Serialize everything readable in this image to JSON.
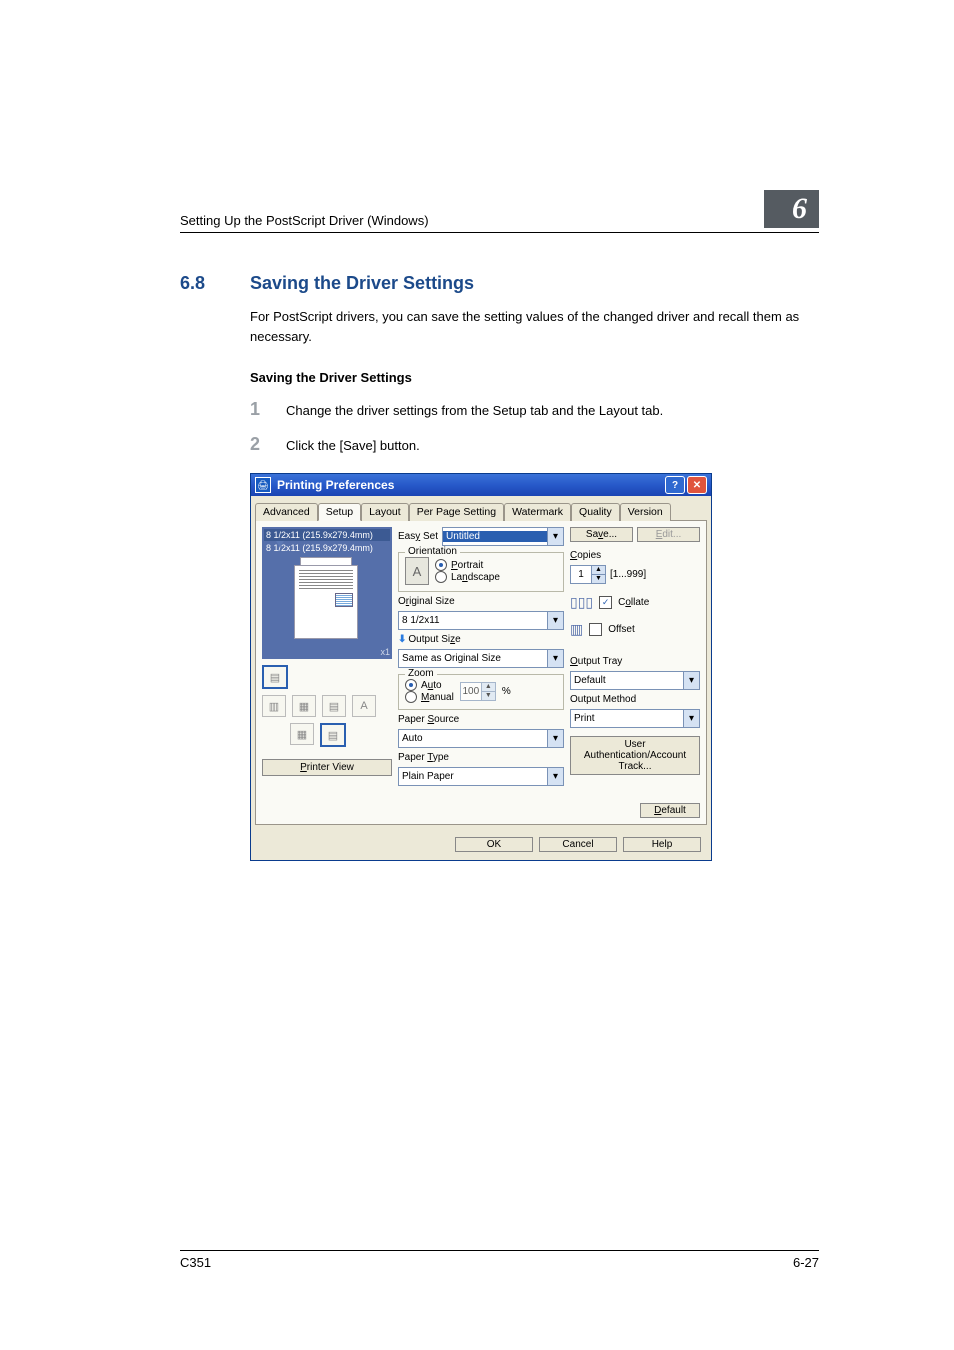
{
  "page": {
    "header_left": "Setting Up the PostScript Driver (Windows)",
    "chapter_badge": "6",
    "section_number": "6.8",
    "section_title": "Saving the Driver Settings",
    "intro": "For PostScript drivers, you can save the setting values of the changed driver and recall them as necessary.",
    "sub_heading": "Saving the Driver Settings",
    "steps": [
      "Change the driver settings from the Setup tab and the Layout tab.",
      "Click the [Save] button."
    ],
    "footer_left": "C351",
    "footer_right": "6-27"
  },
  "dialog": {
    "title": "Printing Preferences",
    "tabs": [
      "Advanced",
      "Setup",
      "Layout",
      "Per Page Setting",
      "Watermark",
      "Quality",
      "Version"
    ],
    "selected_tab": "Setup",
    "easy_set_label": "Easy Set",
    "easy_set_value": "Untitled",
    "save_btn": "Save...",
    "edit_btn": "Edit...",
    "preview": {
      "line1": "8 1/2x11 (215.9x279.4mm)",
      "line2": "8 1/2x11 (215.9x279.4mm)",
      "x1": "x1"
    },
    "printer_view_btn": "Printer View",
    "orientation": {
      "legend": "Orientation",
      "portrait": "Portrait",
      "landscape": "Landscape"
    },
    "original_size_label": "Original Size",
    "original_size_value": "8 1/2x11",
    "output_size_label": "Output Size",
    "output_size_value": "Same as Original Size",
    "zoom": {
      "legend": "Zoom",
      "auto": "Auto",
      "manual": "Manual",
      "value": "100",
      "unit": "%"
    },
    "paper_source_label": "Paper Source",
    "paper_source_value": "Auto",
    "paper_type_label": "Paper Type",
    "paper_type_value": "Plain Paper",
    "copies": {
      "label": "Copies",
      "value": "1",
      "range": "[1...999]",
      "collate": "Collate",
      "offset": "Offset"
    },
    "output_tray_label": "Output Tray",
    "output_tray_value": "Default",
    "output_method_label": "Output Method",
    "output_method_value": "Print",
    "user_auth_btn": "User Authentication/Account Track...",
    "default_btn": "Default",
    "ok_btn": "OK",
    "cancel_btn": "Cancel",
    "help_btn": "Help"
  }
}
